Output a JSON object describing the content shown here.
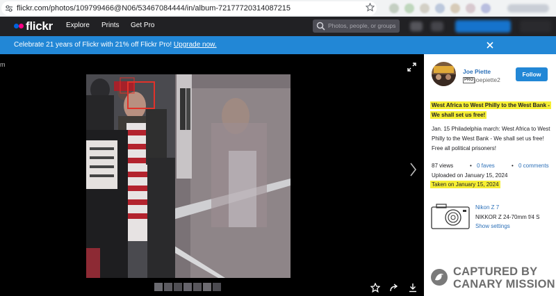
{
  "browser": {
    "url": "flickr.com/photos/109799466@N06/53467084444/in/album-72177720314087215"
  },
  "nav": {
    "logo": "flickr",
    "links": [
      "Explore",
      "Prints",
      "Get Pro"
    ],
    "search_placeholder": "Photos, people, or groups"
  },
  "banner": {
    "text": "Celebrate 21 years of Flickr with 21% off Flickr Pro! ",
    "link": "Upgrade now.",
    "close_icon": "close-icon"
  },
  "viewer": {
    "edge_text": "m",
    "icons": [
      "expand-icon",
      "next-arrow-icon",
      "star-icon",
      "share-icon",
      "download-icon"
    ]
  },
  "panel": {
    "author_name": "Joe Piette",
    "pro_badge": "PRO",
    "username": "joepiette2",
    "follow_label": "Follow",
    "title_line1": "West Africa to West Philly to the West Bank -",
    "title_line2": "We shall set us free!",
    "description": "Jan. 15 Philadelphia march: West Africa to West Philly to the West Bank - We shall set us free! Free all political prisoners!",
    "views": "87 views",
    "faves": "0 faves",
    "comments": "0 comments",
    "uploaded": "Uploaded on January 15, 2024",
    "taken": "Taken on January 15, 2024",
    "camera_model": "Nikon Z 7",
    "lens": "NIKKOR Z 24-70mm f/4 S",
    "show_settings": "Show settings"
  },
  "watermark": {
    "line1": "CAPTURED BY",
    "line2": "CANARY MISSION"
  },
  "colors": {
    "nav_bg": "#212124",
    "banner_bg": "#2287d6",
    "link_blue": "#2c70b8",
    "highlight": "#f6ef34",
    "flickr_blue": "#0063dc",
    "flickr_pink": "#ff0084"
  }
}
